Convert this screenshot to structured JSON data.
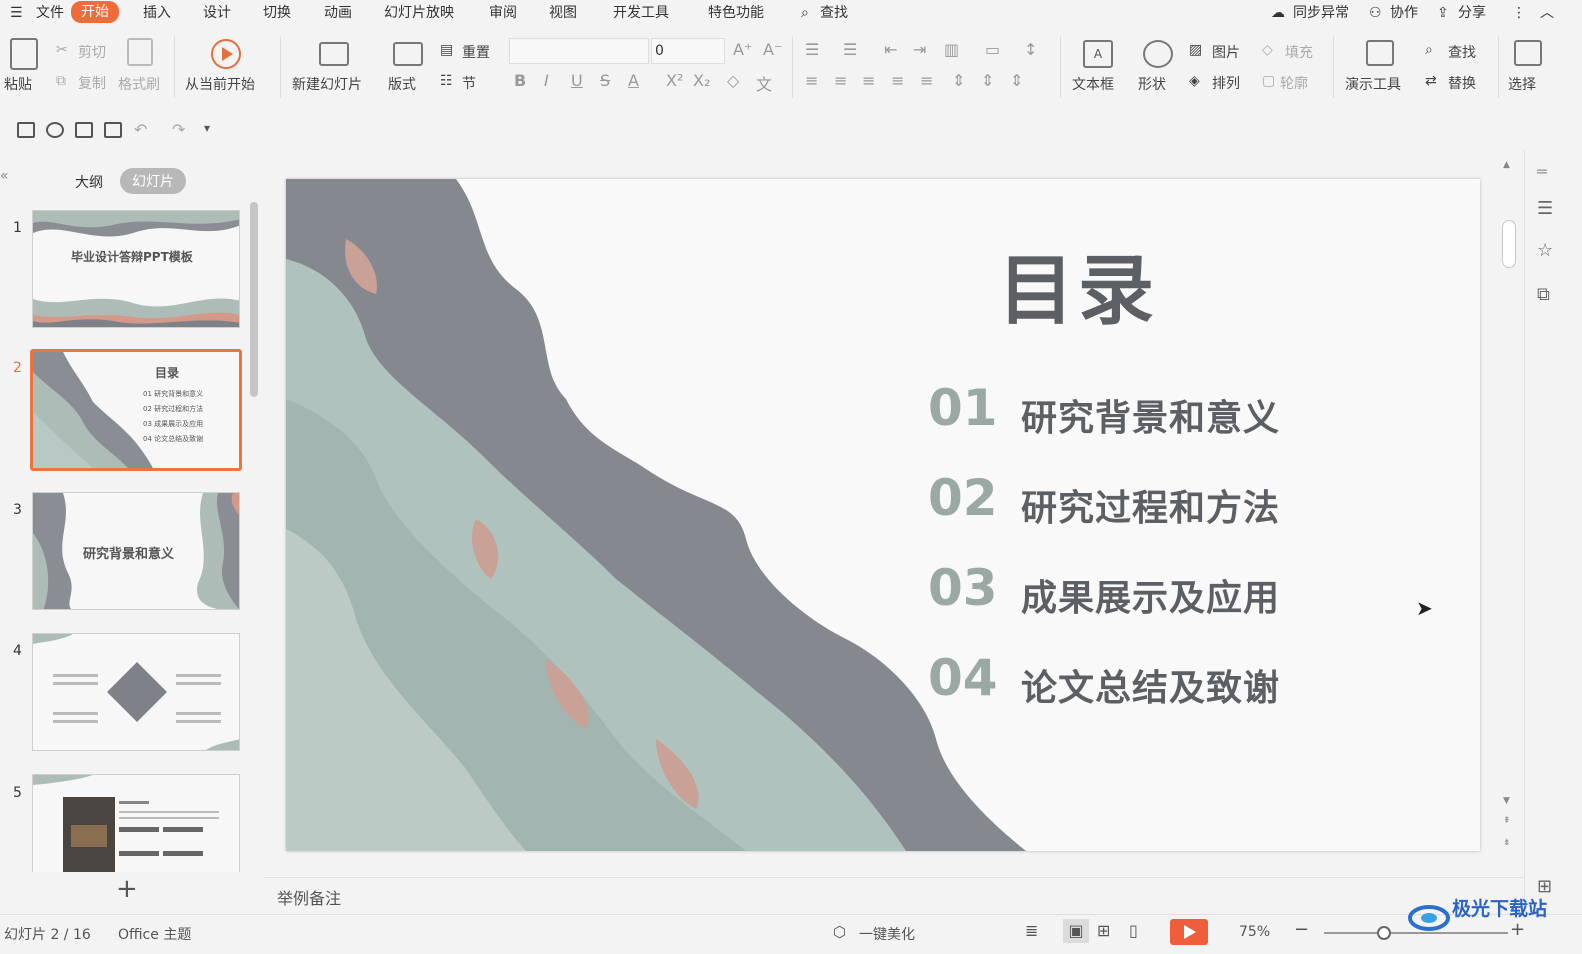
{
  "menu": {
    "file": "文件",
    "items": [
      "开始",
      "插入",
      "设计",
      "切换",
      "动画",
      "幻灯片放映",
      "审阅",
      "视图",
      "开发工具",
      "特色功能"
    ],
    "search": "查找",
    "sync": "同步异常",
    "collab": "协作",
    "share": "分享"
  },
  "ribbon": {
    "paste": "粘贴",
    "cut": "剪切",
    "copy": "复制",
    "format_painter": "格式刷",
    "from_current": "从当前开始",
    "new_slide": "新建幻灯片",
    "layout": "版式",
    "reset": "重置",
    "section": "节",
    "font_size": "0",
    "textbox": "文本框",
    "shape": "形状",
    "picture": "图片",
    "arrange": "排列",
    "fill": "填充",
    "outline": "轮廓",
    "present_tools": "演示工具",
    "find": "查找",
    "replace": "替换",
    "select": "选择"
  },
  "panel": {
    "tab_outline": "大纲",
    "tab_slides": "幻灯片",
    "thumbs": [
      {
        "num": "1",
        "title": "毕业设计答辩PPT模板"
      },
      {
        "num": "2",
        "title": "目录",
        "items": [
          "01  研究背景和意义",
          "02  研究过程和方法",
          "03  成果展示及应用",
          "04  论文总结及致谢"
        ]
      },
      {
        "num": "3",
        "title": "研究背景和意义"
      },
      {
        "num": "4",
        "title": ""
      },
      {
        "num": "5",
        "title": ""
      }
    ]
  },
  "slide": {
    "title": "目录",
    "items": [
      {
        "num": "01",
        "text": "研究背景和意义"
      },
      {
        "num": "02",
        "text": "研究过程和方法"
      },
      {
        "num": "03",
        "text": "成果展示及应用"
      },
      {
        "num": "04",
        "text": "论文总结及致谢"
      }
    ]
  },
  "notes_placeholder": "举例备注",
  "status": {
    "slide_count": "幻灯片 2 / 16",
    "theme": "Office 主题",
    "beautify": "一键美化",
    "zoom": "75%"
  },
  "watermark": "极光下载站",
  "colors": {
    "accent": "#ee6b3a",
    "num_color": "#9aa9a5",
    "text_color": "#5c5f63"
  }
}
